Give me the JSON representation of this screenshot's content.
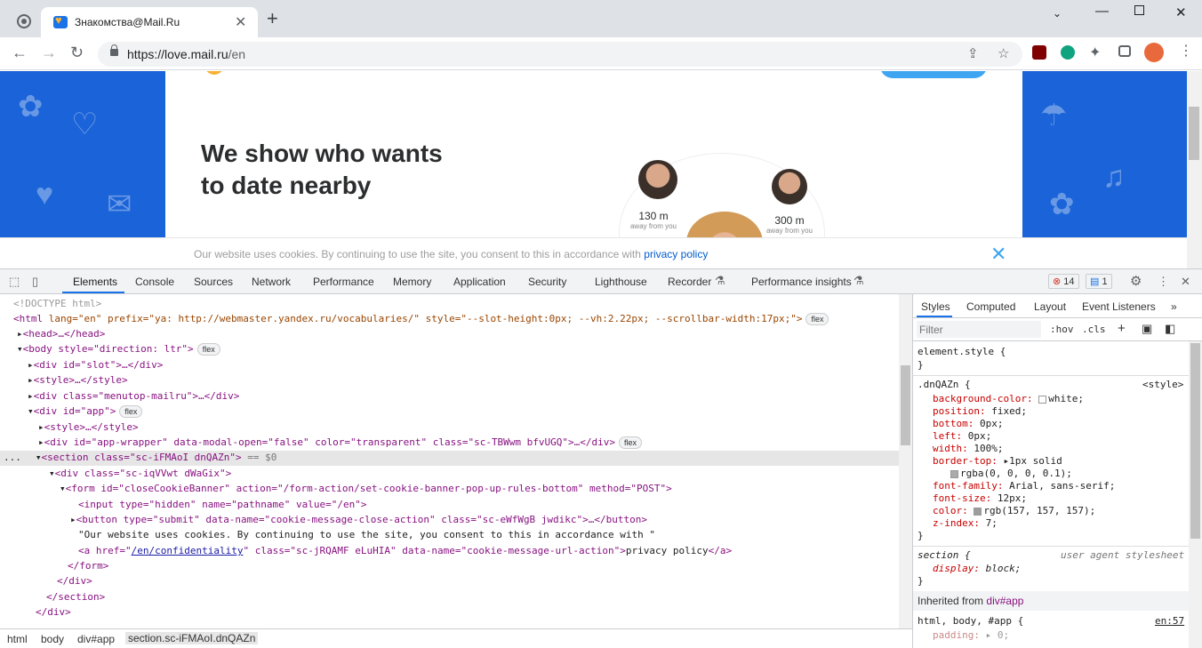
{
  "browser": {
    "tab_title": "Знакомства@Mail.Ru",
    "url_host": "https://love.mail.ru",
    "url_path": "/en",
    "new_tab": "+",
    "tab_close": "✕"
  },
  "page": {
    "headline_line1": "We show who wants",
    "headline_line2": "to date nearby",
    "dist1": "130 m",
    "dist1_sub": "away from you",
    "dist2": "300 m",
    "dist2_sub": "away from you",
    "cookie_text": "Our website uses cookies. By continuing to use the site, you consent to this in accordance with",
    "cookie_link": "privacy policy",
    "cookie_close": "✕"
  },
  "devtools": {
    "tabs": [
      "Elements",
      "Console",
      "Sources",
      "Network",
      "Performance",
      "Memory",
      "Application",
      "Security",
      "Lighthouse",
      "Recorder",
      "Performance insights"
    ],
    "errors_count": "14",
    "messages_count": "1",
    "dom": {
      "l0": "<!DOCTYPE html>",
      "l1_tag": "<html",
      "l1_attrs": " lang=\"en\" prefix=\"ya: http://webmaster.yandex.ru/vocabularies/\" style=\"--slot-height:0px; --vh:2.22px; --scrollbar-width:17px;\">",
      "l2": "<head>…</head>",
      "l3": "<body style=\"direction: ltr\">",
      "l4": "<div id=\"slot\">…</div>",
      "l5": "<style>…</style>",
      "l6": "<div class=\"menutop-mailru\">…</div>",
      "l7": "<div id=\"app\">",
      "l8": "<style>…</style>",
      "l9": "<div id=\"app-wrapper\" data-modal-open=\"false\" color=\"transparent\" class=\"sc-TBWwm bfvUGQ\">…</div>",
      "l10": "<section class=\"sc-iFMAoI dnQAZn\">",
      "l10_eq": " == $0",
      "l11": "<div class=\"sc-iqVVwt dWaGix\">",
      "l12": "<form id=\"closeCookieBanner\" action=\"/form-action/set-cookie-banner-pop-up-rules-bottom\" method=\"POST\">",
      "l13": "<input type=\"hidden\" name=\"pathname\" value=\"/en\">",
      "l14": "<button type=\"submit\" data-name=\"cookie-message-close-action\" class=\"sc-eWfWgB jwdikc\">…</button>",
      "l15": "\"Our website uses cookies. By continuing to use the site, you consent to this in accordance with \"",
      "l16_a": "<a href=\"",
      "l16_href": "/en/confidentiality",
      "l16_b": "\" class=\"sc-jRQAMF eLuHIA\" data-name=\"cookie-message-url-action\">",
      "l16_text": "privacy policy",
      "l16_c": "</a>",
      "l17": "</form>",
      "l18": "</div>",
      "l19": "</section>",
      "l20": "</div>",
      "flex": "flex",
      "ellipsis": "..."
    },
    "breadcrumbs": [
      "html",
      "body",
      "div#app",
      "section.sc-iFMAoI.dnQAZn"
    ],
    "styles_tabs": [
      "Styles",
      "Computed",
      "Layout",
      "Event Listeners",
      "»"
    ],
    "filter_placeholder": "Filter",
    "hov": ":hov",
    "cls": ".cls",
    "rules": {
      "element_style": "element.style {",
      "close": "}",
      "sel1": ".dnQAZn {",
      "src1": "<style>",
      "p1": "background-color:",
      "v1": "white;",
      "p2": "position:",
      "v2": "fixed;",
      "p3": "bottom:",
      "v3": "0px;",
      "p4": "left:",
      "v4": "0px;",
      "p5": "width:",
      "v5": "100%;",
      "p6": "border-top:",
      "v6": "1px solid",
      "v6b": "rgba(0, 0, 0, 0.1);",
      "p7": "font-family:",
      "v7": "Arial, sans-serif;",
      "p8": "font-size:",
      "v8": "12px;",
      "p9": "color:",
      "v9": "rgb(157, 157, 157);",
      "p10": "z-index:",
      "v10": "7;",
      "sel2": "section {",
      "src2": "user agent stylesheet",
      "p11": "display:",
      "v11": "block;",
      "inherited_label": "Inherited from",
      "inherited_from": "div#app",
      "sel3": "html, body, #app {",
      "src3": "en:57",
      "p12": "padding:",
      "v12": "0;"
    }
  },
  "colors": {
    "accent": "#1a73e8",
    "page_bg": "#1a63d8",
    "cookie_link": "#005bd1"
  }
}
